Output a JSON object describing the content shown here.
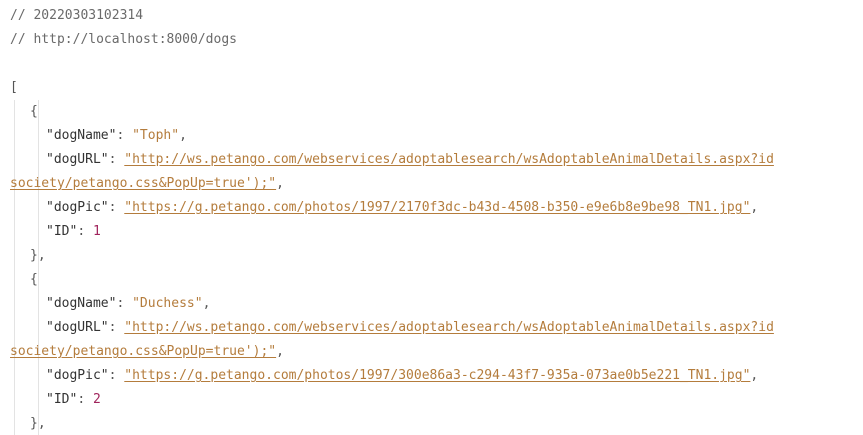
{
  "header": {
    "timestamp_comment": "// 20220303102314",
    "url_comment": "// http://localhost:8000/dogs"
  },
  "punct": {
    "open_bracket": "[",
    "open_brace": "{",
    "close_brace_comma": "},",
    "colon": ": ",
    "comma": ","
  },
  "keys": {
    "dogName": "\"dogName\"",
    "dogURL": "\"dogURL\"",
    "dogPic": "\"dogPic\"",
    "ID": "\"ID\""
  },
  "dogs": [
    {
      "dogName": "\"Toph\"",
      "dogURL_line1": "\"http://ws.petango.com/webservices/adoptablesearch/wsAdoptableAnimalDetails.aspx?id",
      "dogURL_line2": "society/petango.css&PopUp=true');\"",
      "dogPic": "\"https://g.petango.com/photos/1997/2170f3dc-b43d-4508-b350-e9e6b8e9be98_TN1.jpg\"",
      "ID": "1"
    },
    {
      "dogName": "\"Duchess\"",
      "dogURL_line1": "\"http://ws.petango.com/webservices/adoptablesearch/wsAdoptableAnimalDetails.aspx?id",
      "dogURL_line2": "society/petango.css&PopUp=true');\"",
      "dogPic": "\"https://g.petango.com/photos/1997/300e86a3-c294-43f7-935a-073ae0b5e221_TN1.jpg\"",
      "ID": "2"
    }
  ]
}
